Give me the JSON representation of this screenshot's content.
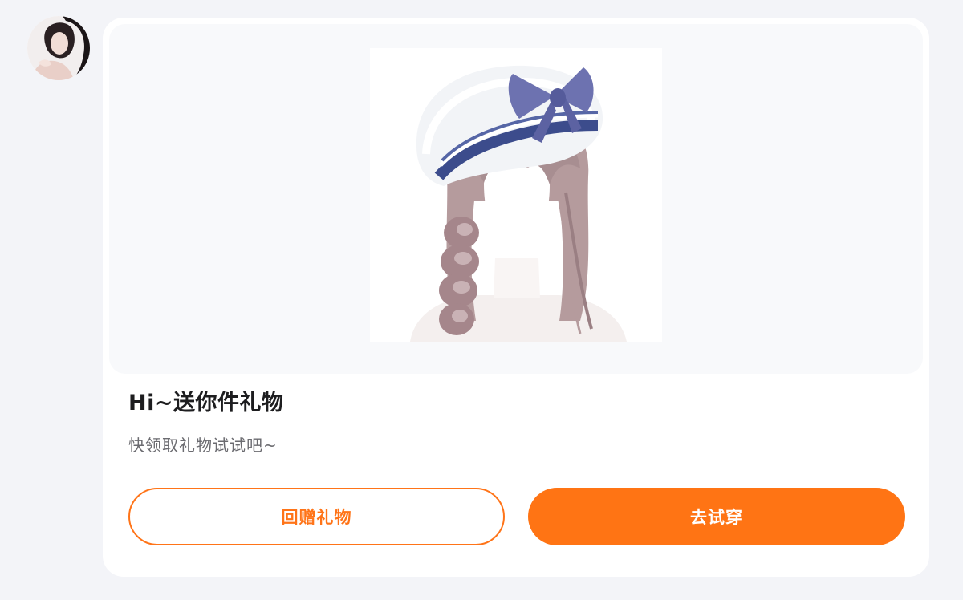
{
  "sender": {
    "avatar_icon": "user-avatar-photo"
  },
  "gift_card": {
    "image_icon": "hairstyle-sailor-beret-braids",
    "title": "Hi~送你件礼物",
    "subtitle": "快领取礼物试试吧~",
    "buttons": {
      "return_gift_label": "回赠礼物",
      "try_on_label": "去试穿"
    }
  },
  "colors": {
    "accent": "#ff7414",
    "page_background": "#f3f4f8",
    "card_background": "#ffffff",
    "title_text": "#1d1d1f",
    "subtitle_text": "#6b6b70"
  }
}
